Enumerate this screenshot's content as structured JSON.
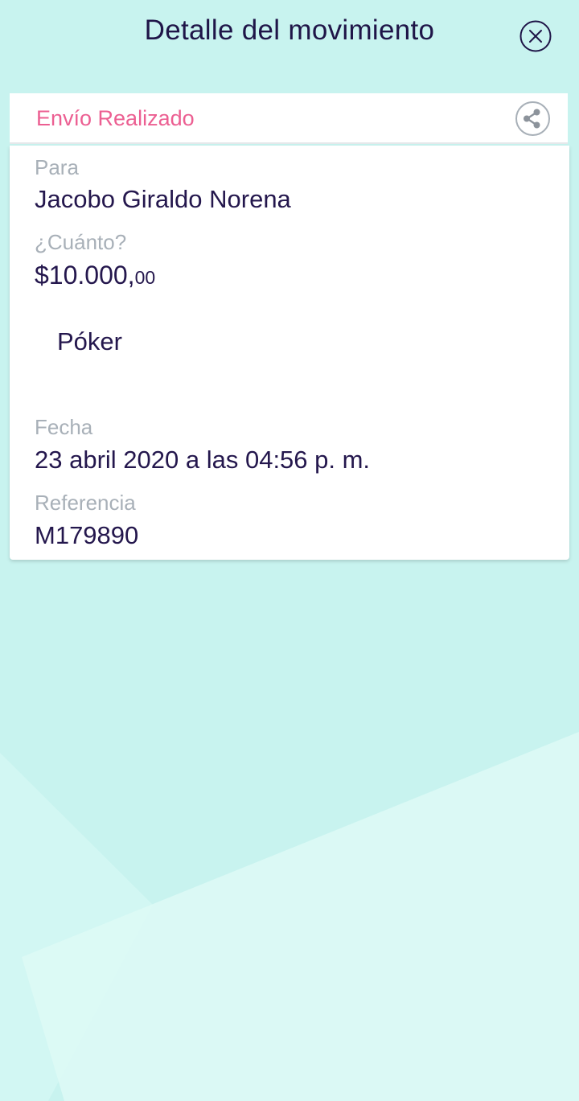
{
  "header": {
    "title": "Detalle del movimiento",
    "close_icon": "close-circle-icon"
  },
  "card": {
    "status_title": "Envío Realizado",
    "share_icon": "share-icon",
    "fields": {
      "recipient_label": "Para",
      "recipient_value": "Jacobo Giraldo Norena",
      "amount_label": "¿Cuánto?",
      "amount_value": "$10.000,",
      "amount_cents": "00",
      "note": "Póker",
      "date_label": "Fecha",
      "date_value": "23 abril 2020 a las 04:56 p. m.",
      "reference_label": "Referencia",
      "reference_value": "M179890"
    }
  },
  "colors": {
    "background": "#c8f3ef",
    "title": "#1f1548",
    "status": "#ec5f92",
    "label": "#a8b0b8",
    "value": "#24174d"
  }
}
